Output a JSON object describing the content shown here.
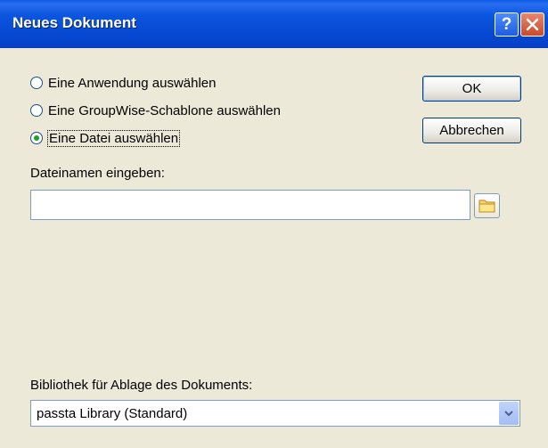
{
  "window": {
    "title": "Neues Dokument",
    "help_label": "?"
  },
  "options": [
    {
      "label": "Eine Anwendung auswählen",
      "selected": false
    },
    {
      "label": "Eine GroupWise-Schablone auswählen",
      "selected": false
    },
    {
      "label": "Eine Datei auswählen",
      "selected": true
    }
  ],
  "buttons": {
    "ok_label": "OK",
    "cancel_label": "Abbrechen"
  },
  "filename": {
    "label": "Dateinamen eingeben:",
    "value": ""
  },
  "library": {
    "label": "Bibliothek für Ablage des Dokuments:",
    "selected": "passta Library  (Standard)"
  },
  "icons": {
    "browse": "folder-icon",
    "dropdown": "chevron-down-icon",
    "close": "close-icon"
  },
  "colors": {
    "titlebar": "#0a5ae6",
    "dialog_bg": "#ece9d8",
    "radio_selected": "#21a121",
    "close_button": "#c94a2a"
  }
}
